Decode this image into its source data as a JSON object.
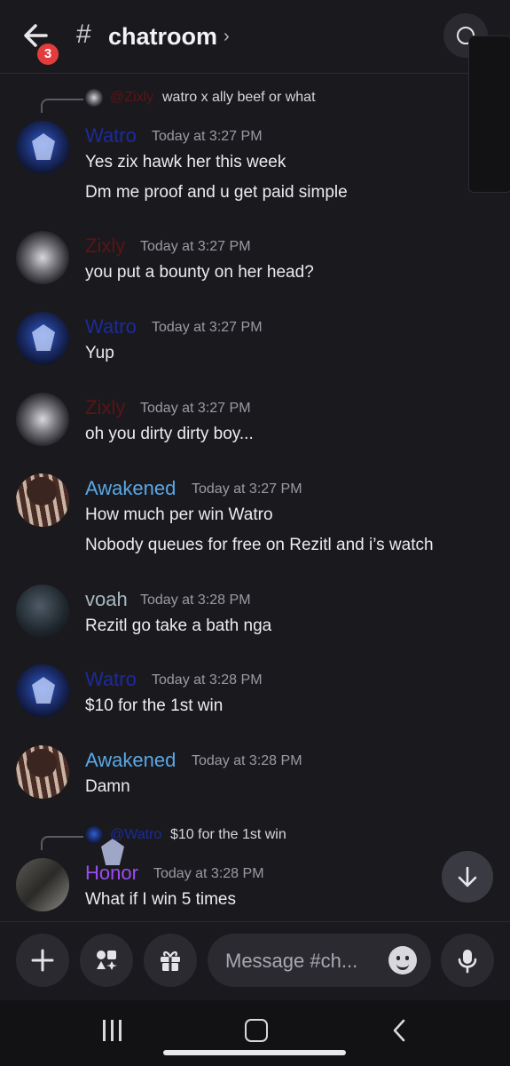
{
  "header": {
    "notification_count": "3",
    "hash_symbol": "#",
    "channel_name": "chatroom",
    "chevron": "›"
  },
  "colors": {
    "watro": "#1c2a9c",
    "zixly": "#5b1414",
    "awakened": "#5aa7e6",
    "voah": "#a8b8c2",
    "honor": "#9d4bf2"
  },
  "messages": [
    {
      "reply": {
        "mention": "@Zixly",
        "text": "watro x ally beef or what"
      },
      "author": "Watro",
      "time": "Today at 3:27 PM",
      "lines": [
        "Yes zix hawk her this week",
        "Dm me proof and u get paid simple"
      ]
    },
    {
      "author": "Zixly",
      "time": "Today at 3:27 PM",
      "lines": [
        "you put a bounty on her head?"
      ]
    },
    {
      "author": "Watro",
      "time": "Today at 3:27 PM",
      "lines": [
        "Yup"
      ]
    },
    {
      "author": "Zixly",
      "time": "Today at 3:27 PM",
      "lines": [
        "oh you dirty dirty boy..."
      ]
    },
    {
      "author": "Awakened",
      "time": "Today at 3:27 PM",
      "lines": [
        "How much per win Watro",
        "Nobody queues for free on Rezitl and i’s watch"
      ]
    },
    {
      "author": "voah",
      "time": "Today at 3:28 PM",
      "lines": [
        "Rezitl go take a bath nga"
      ]
    },
    {
      "author": "Watro",
      "time": "Today at 3:28 PM",
      "lines": [
        "$10 for the 1st win"
      ]
    },
    {
      "author": "Awakened",
      "time": "Today at 3:28 PM",
      "lines": [
        "Damn"
      ]
    },
    {
      "reply": {
        "mention": "@Watro",
        "text": "$10 for the 1st win"
      },
      "author": "Honor",
      "time": "Today at 3:28 PM",
      "lines": [
        "What if I win 5 times"
      ]
    }
  ],
  "composer": {
    "placeholder": "Message #ch..."
  },
  "icons": {
    "back": "arrow-left-icon",
    "add": "plus-icon",
    "apps": "apps-icon",
    "gift": "gift-icon",
    "emoji": "emoji-icon",
    "mic": "microphone-icon",
    "jump": "arrow-down-icon"
  }
}
